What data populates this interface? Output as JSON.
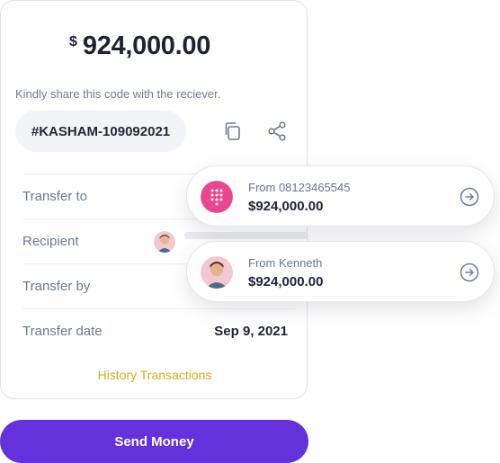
{
  "balance": {
    "currency": "$",
    "amount": "924,000.00"
  },
  "share": {
    "hint": "Kindly share this code with the reciever.",
    "code": "#KASHAM-109092021",
    "copy_icon": "copy-icon",
    "share_icon": "share-icon"
  },
  "details": {
    "transfer_to_label": "Transfer to",
    "recipient_label": "Recipient",
    "transfer_by_label": "Transfer by",
    "transfer_date_label": "Transfer date",
    "transfer_date_value": "Sep 9, 2021"
  },
  "history_link": "History Transactions",
  "send_button": "Send Money",
  "notifications": [
    {
      "from": "From 08123465545",
      "amount": "$924,000.00",
      "icon": "keypad-icon"
    },
    {
      "from": "From Kenneth",
      "amount": "$924,000.00",
      "icon": "avatar"
    }
  ],
  "colors": {
    "accent": "#6431dc",
    "history_link": "#c8b21c",
    "keypad_badge": "#e9468f"
  }
}
